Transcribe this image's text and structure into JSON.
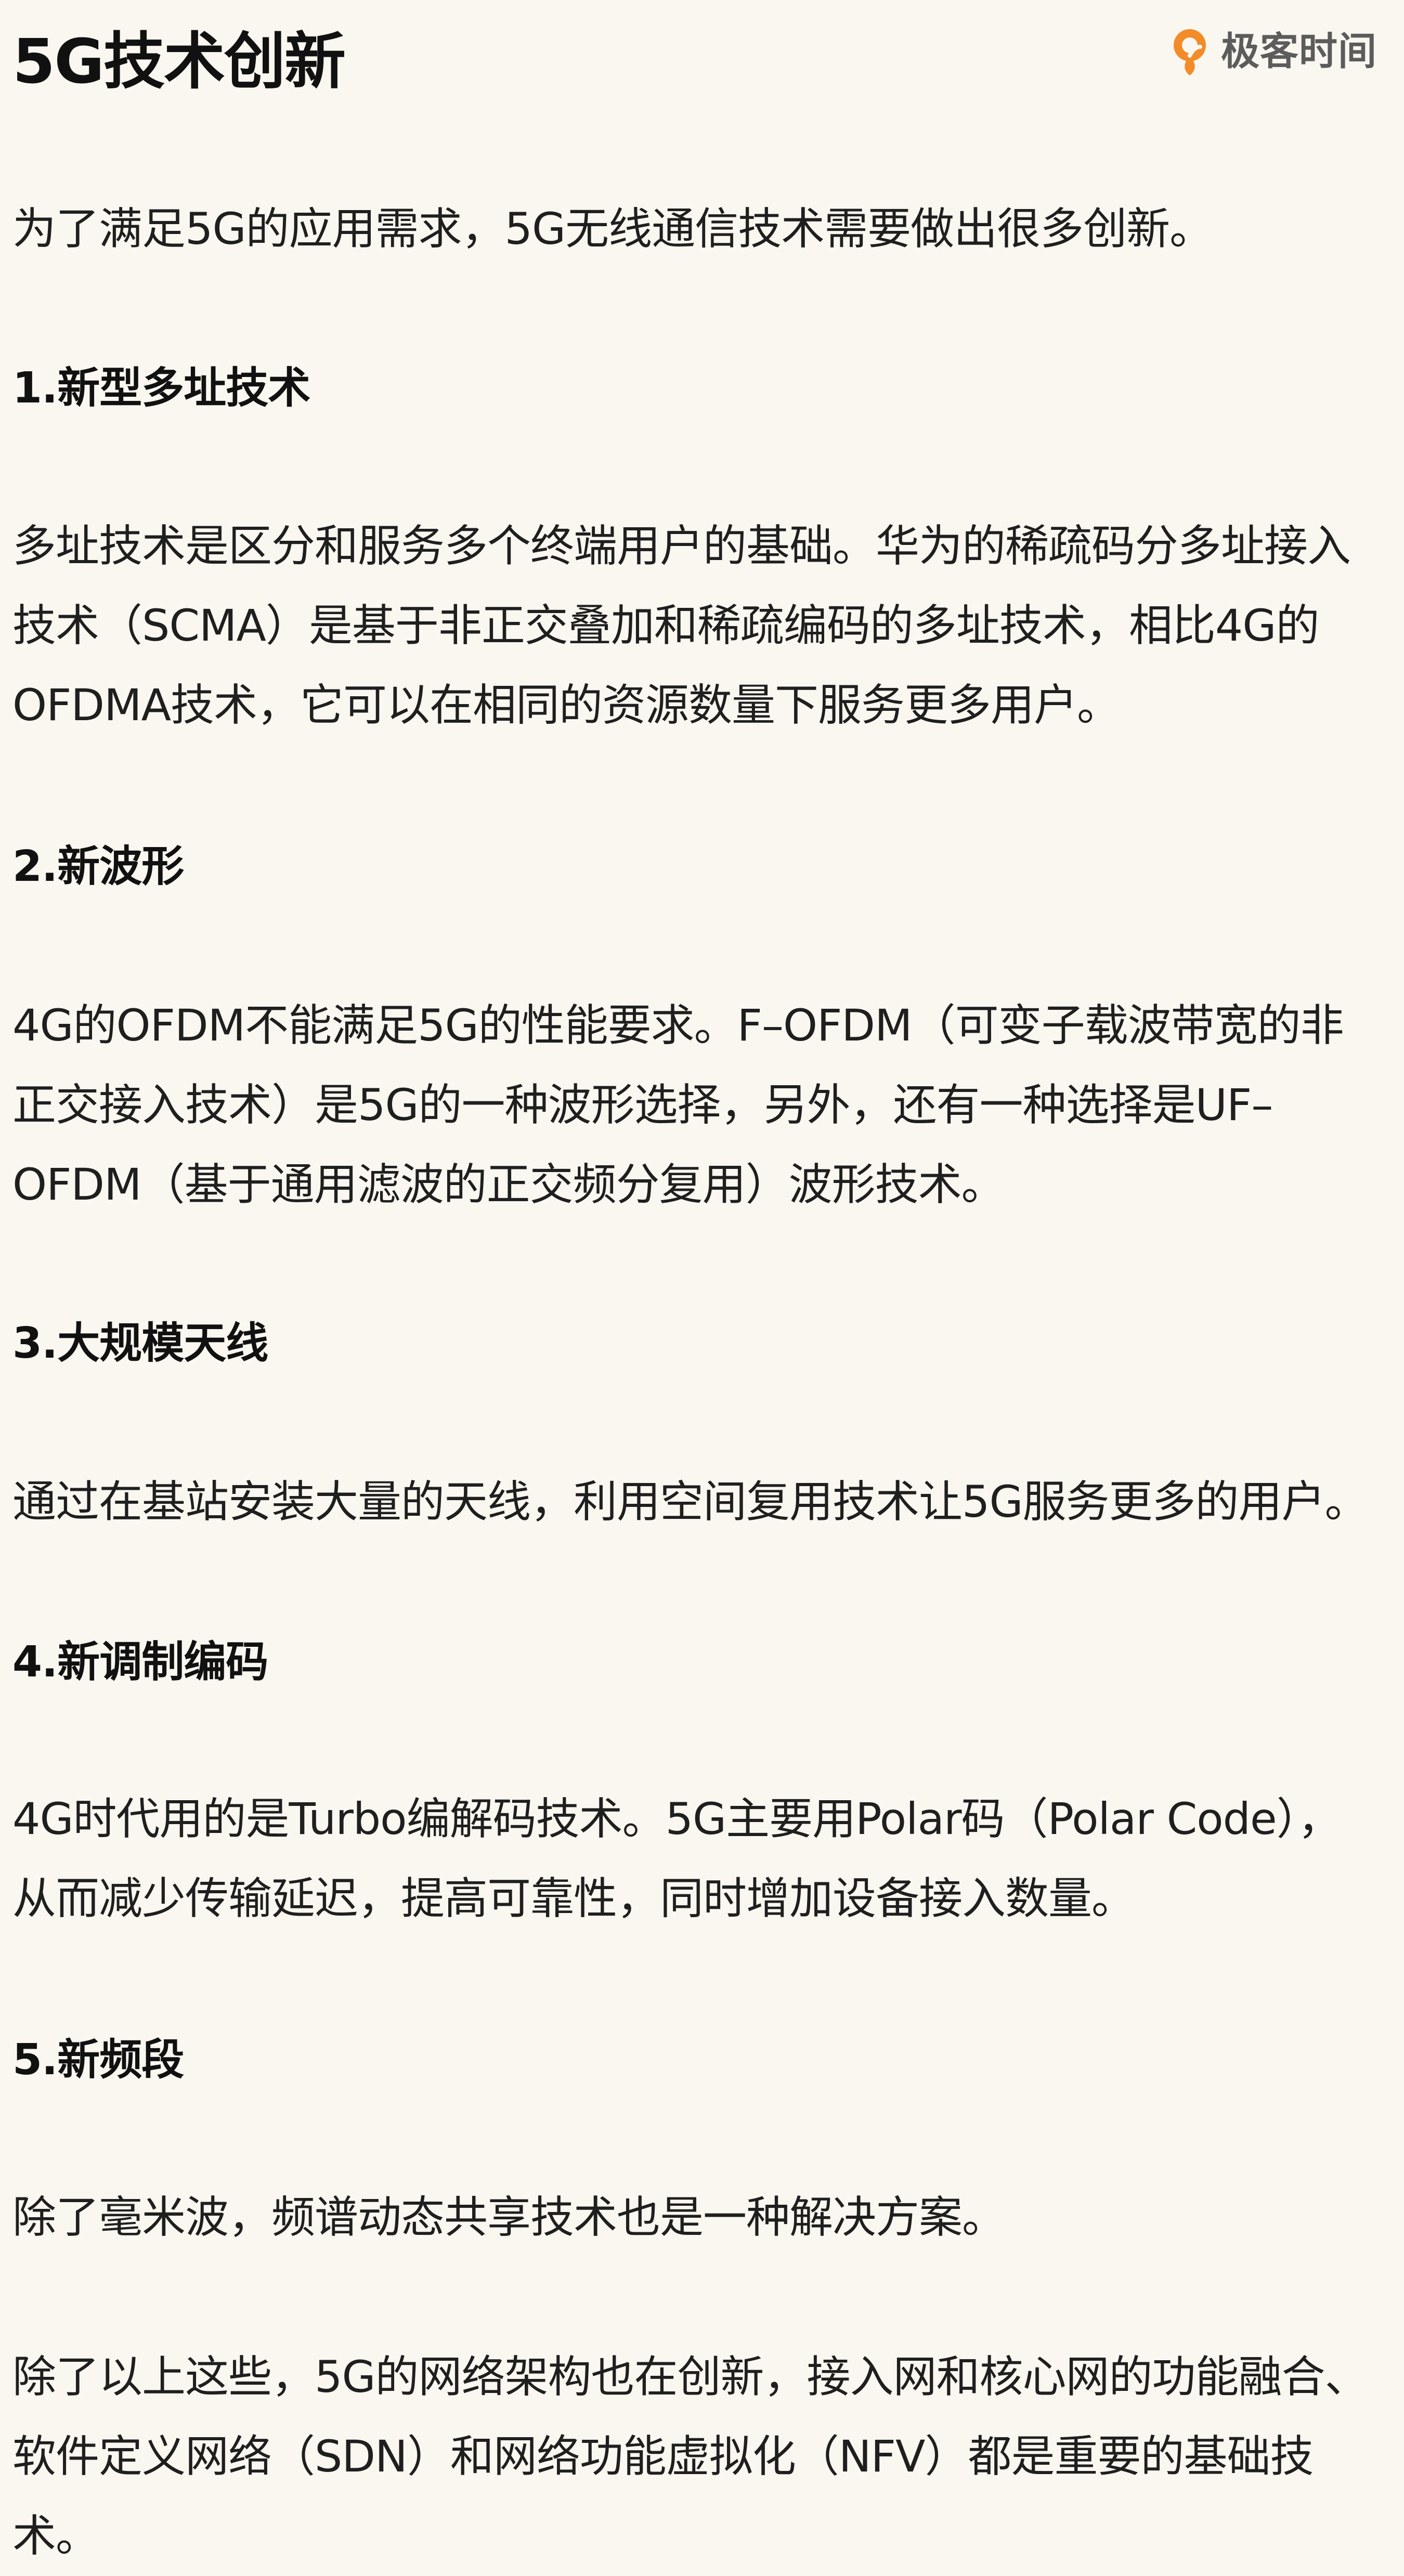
{
  "header": {
    "title": "5G技术创新",
    "brand": "极客时间"
  },
  "content": {
    "intro": "为了满足5G的应用需求，5G无线通信技术需要做出很多创新。",
    "sections": [
      {
        "heading": "1.新型多址技术",
        "lines": [
          "多址技术是区分和服务多个终端用户的基础。华为的稀疏码分多址接入",
          "技术（SCMA）是基于非正交叠加和稀疏编码的多址技术，相比4G的",
          "OFDMA技术，它可以在相同的资源数量下服务更多用户。"
        ]
      },
      {
        "heading": "2.新波形",
        "lines": [
          "4G的OFDM不能满足5G的性能要求。F–OFDM（可变子载波带宽的非",
          "正交接入技术）是5G的一种波形选择，另外，还有一种选择是UF–",
          "OFDM（基于通用滤波的正交频分复用）波形技术。"
        ]
      },
      {
        "heading": "3.大规模天线",
        "lines": [
          "通过在基站安装大量的天线，利用空间复用技术让5G服务更多的用户。"
        ]
      },
      {
        "heading": "4.新调制编码",
        "lines": [
          "4G时代用的是Turbo编解码技术。5G主要用Polar码（Polar Code），",
          "从而减少传输延迟，提高可靠性，同时增加设备接入数量。"
        ]
      },
      {
        "heading": "5.新频段",
        "lines": [
          "除了毫米波，频谱动态共享技术也是一种解决方案。"
        ]
      }
    ],
    "closing": [
      "除了以上这些，5G的网络架构也在创新，接入网和核心网的功能融合、",
      "软件定义网络（SDN）和网络功能虚拟化（NFV）都是重要的基础技术。"
    ]
  },
  "colors": {
    "background": "#faf7f0",
    "text": "#1f1f1f",
    "brand_accent": "#f28c28"
  },
  "icons": {
    "brand_logo": "geek-time-logo-icon"
  }
}
